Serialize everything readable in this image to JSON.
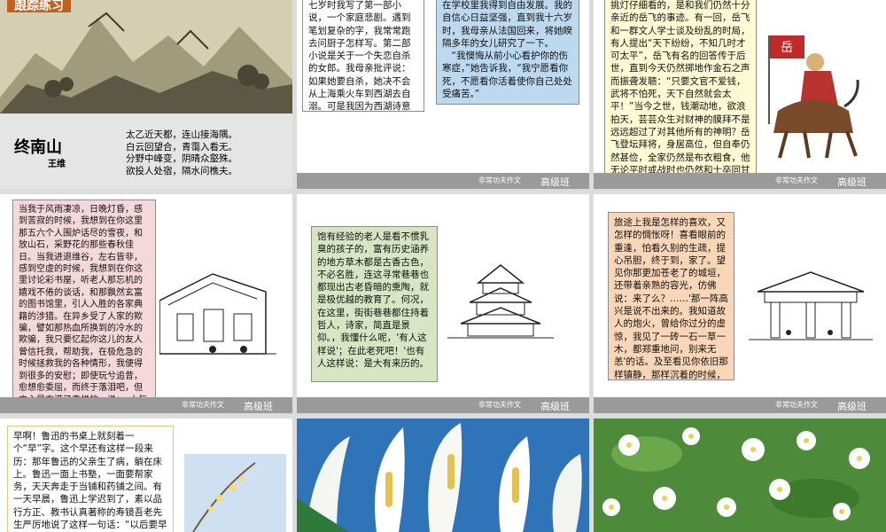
{
  "footer": {
    "brand": "非常功夫作文",
    "level": "高级班"
  },
  "slide1": {
    "tag": "跟踪练习",
    "poem_title": "终南山",
    "poem_author": "王维",
    "poem_lines": [
      "太乙近天都，连山接海隅。",
      "白云回望合，青霭入看无。",
      "分野中峰变，阴晴众壑殊。",
      "欲投人处宿，隔水问樵夫。"
    ]
  },
  "slide2": {
    "text": "七岁时我写了第一部小说，一个家庭悲剧。遇到笔划复杂的字，我常常跑去问厨子怎样写。第二部小说是关于一个失恋自杀的女郎。我母亲批评说：如果她要自杀，她决不会从上海乘火车到西湖去自溺。可是我因为西湖诗意的背景，终于固执地保存"
  },
  "slide3": {
    "text1": "在学校里我得到自由发展。我的自信心日益坚强，直到我十六岁时，我母亲从法国回来，将她睽隔多年的女儿研究了一下。",
    "text2": "“我懊悔从前小心看护你的伤寒症，”她告诉我，“我宁愿看你死，不愿看你活着使你自己处处受痛苦。”"
  },
  "slide4": {
    "text": "挑灯仔细看的，是和我们仍然十分亲近的岳飞的事迹。有一回，岳飞和一群文人学士谈及纷乱的时局，有人提出“天下纷纷，不知几时才可太平”，岳飞有名的回答传于后世，直到今天仍然掷地作金石之声而振聋发聩：“只要文官不爱钱，武将不怕死，天下自然就会太平！”当今之世，钱潮动地，欲浪拍天，芸芸众生对财神的膜拜不是远远超过了对其他所有的神明？岳飞登坛拜将，身居高位，但自奉仍然甚俭，全家仍然是布衣粗食，他无论平时或战时也仍然和士卒同甘共苦，这样，岳飞的部队上下一心，真正是“战无不胜”，连强敌也无可奈何地惊呼“撼山易，撼岳家军难”！"
  },
  "slide5": {
    "text": "当我于风雨凄凉，日晚灯昏，感到苦寂的时候，我想到在你这里那五六个人围炉话尽的雪夜，和放山石，采野花的那些春秋佳日。当我进退维谷，左右皆非，感到空虚的时候，我想到在你这里讨论彩书屋，听老人那忘机的嬉戏不倦的谈话，和那飘然玄富的图书馆里，引人入胜的各家典籍的涉猎。在异乡受了人家的欺骗，譬如那热血所换到的冷水的欺骗，我只要忆起你这儿的友人曾信托我，帮助我，在极危急的时候拯救我的各种情形，我便得到很多的安慰；即使玩兮追昔，愈想愈委屈，而终于落泪吧，但内心是充满了喜悦的，说：，小气的人呀！我是有朋友的，你其奈我 何！"
  },
  "slide6": {
    "text": "饱有经验的老人是看不惯乳臭的孩子的，富有历史涵养的地方草木都是古香古色，不必名胜，连这寻常巷巷也都现出古老昏暗的熏陶，就是极优越的教育了。何况，在这里，街街巷巷都住持着哲人，诗家，简直是景仰。，我懂什么呢，'有人这样说'；在此老死吧！'也有人这样说：是大有来历的。"
  },
  "slide7": {
    "text": "旅途上我是怎样的喜欢，又怎样的惆怅呀！喜看眼前的重逢，怕看久别的生疏，提心吊胆，终于到，家了。望见你那更加苍老了的城垣，还带着亲熟的容光，仿佛说：来了么？……'那一阵高兴是说不出来的。我知道故人的炮火，曾给你过分的虚惊，我见了一砖一石一草一木，都郑重地问，别来无恙'的话。及至看见你依旧那样镇静，那样沉着的时候，我便禁不住手舞足蹈了。"
  },
  "slide8": {
    "text": "早啊！鲁迅的书桌上就刻着一个“早”字。这个早还有这样一段来历：那年鲁迅的父亲生了病，躺在床上。鲁迅一面上书塾，一面要帮家务，天天奔走于当铺和药铺之间。有一天早晨，鲁迅上学迟到了，素以品行方正、教书认真著称的寿镜吾老先生严厉地说了这样一句话：“以后要早到！”鲁迅"
  },
  "colors": {
    "pink": "#f5d8dc",
    "sky": "#bcd9ef",
    "cream": "#fcfbd3",
    "green": "#d7e5c3",
    "peach": "#f9d6b8",
    "footer": "#9a9a9a"
  }
}
